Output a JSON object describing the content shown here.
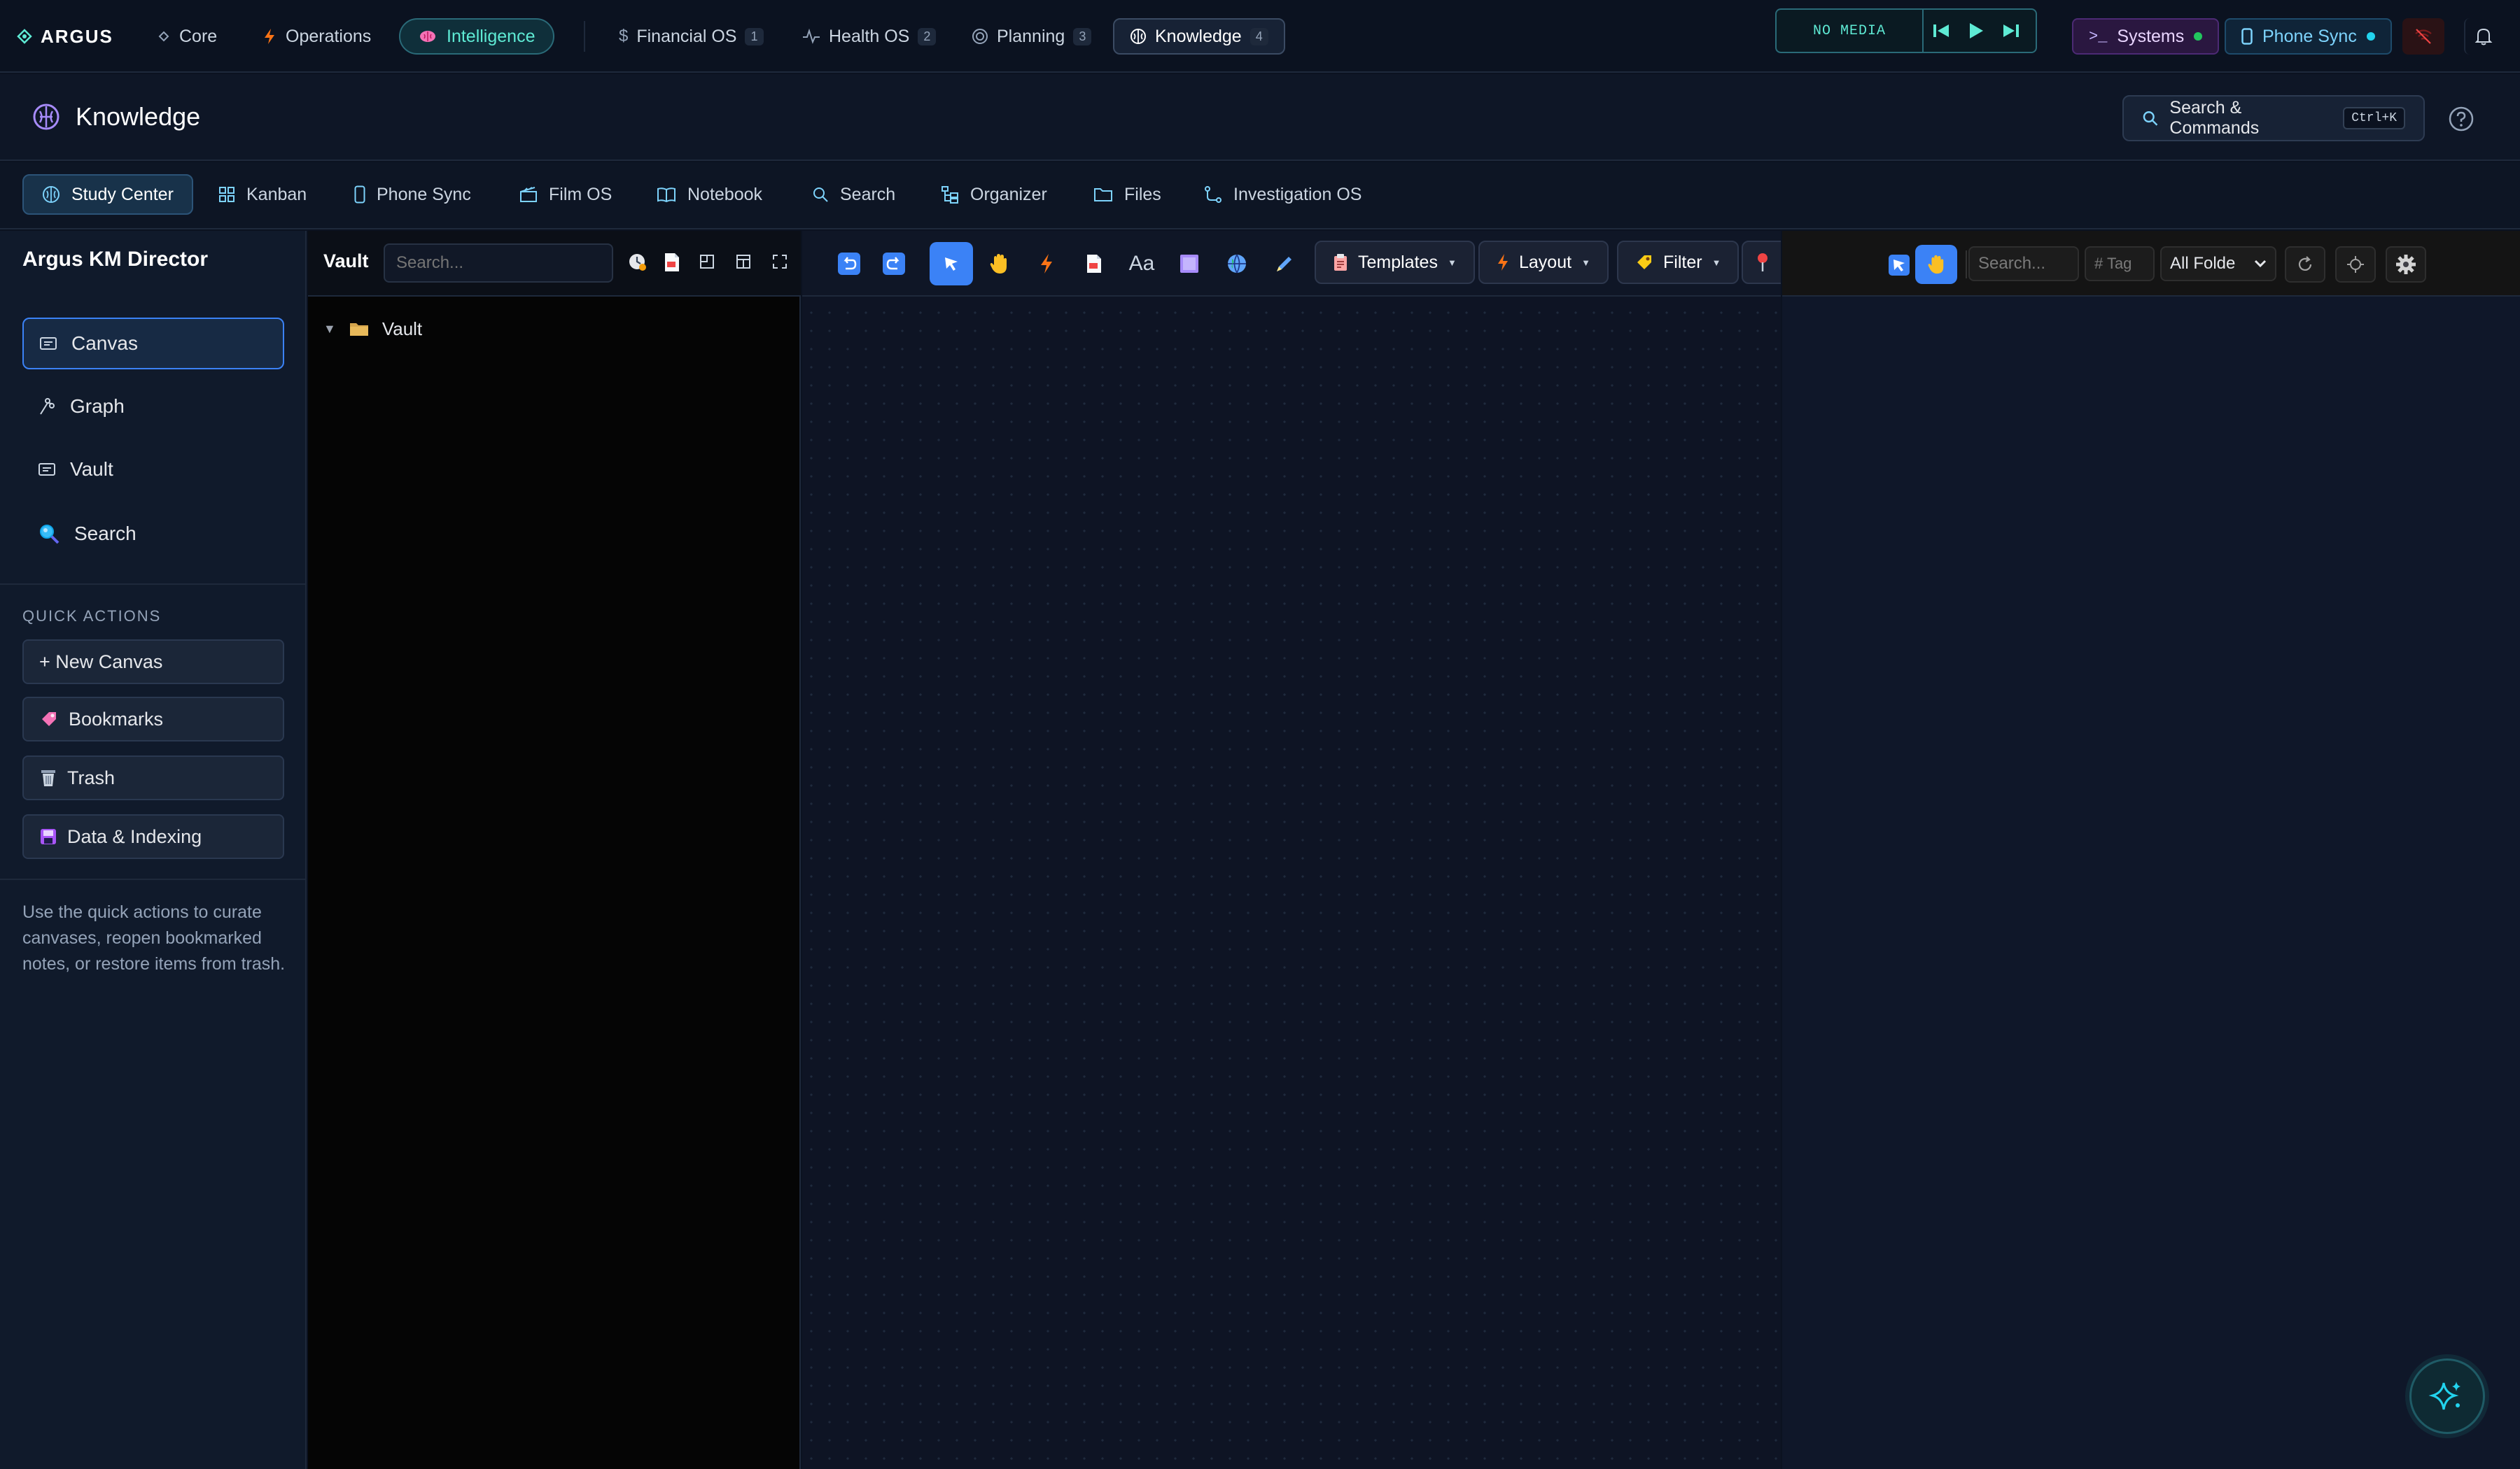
{
  "topbar": {
    "brand": "ARGUS",
    "nav": [
      {
        "label": "Core",
        "icon": "diamond-icon"
      },
      {
        "label": "Operations",
        "icon": "bolt-icon"
      },
      {
        "label": "Intelligence",
        "icon": "brain-icon",
        "active": true
      }
    ],
    "os_nav": [
      {
        "label": "Financial OS",
        "badge": "1",
        "icon": "dollar-icon"
      },
      {
        "label": "Health OS",
        "badge": "2",
        "icon": "pulse-icon"
      },
      {
        "label": "Planning",
        "badge": "3",
        "icon": "target-icon"
      },
      {
        "label": "Knowledge",
        "badge": "4",
        "icon": "brain-icon",
        "active": true
      }
    ],
    "media": {
      "status": "NO MEDIA"
    },
    "systems_label": "Systems",
    "phone_sync_label": "Phone Sync"
  },
  "header": {
    "title": "Knowledge",
    "search_label": "Search & Commands",
    "shortcut": "Ctrl+K"
  },
  "tabs": [
    {
      "label": "Study Center",
      "icon": "brain-icon",
      "active": true
    },
    {
      "label": "Kanban",
      "icon": "grid-icon"
    },
    {
      "label": "Phone Sync",
      "icon": "phone-icon"
    },
    {
      "label": "Film OS",
      "icon": "clapper-icon"
    },
    {
      "label": "Notebook",
      "icon": "book-icon"
    },
    {
      "label": "Search",
      "icon": "search-icon"
    },
    {
      "label": "Organizer",
      "icon": "tree-icon"
    },
    {
      "label": "Files",
      "icon": "folder-icon"
    },
    {
      "label": "Investigation OS",
      "icon": "graph-icon"
    }
  ],
  "sidebar": {
    "title": "Argus KM Director",
    "items": [
      {
        "label": "Canvas",
        "icon": "canvas-icon",
        "active": true
      },
      {
        "label": "Graph",
        "icon": "graph-icon"
      },
      {
        "label": "Vault",
        "icon": "vault-icon"
      },
      {
        "label": "Search",
        "icon": "magnifier-icon"
      }
    ],
    "quick_actions_title": "QUICK ACTIONS",
    "quick_actions": [
      {
        "label": "+ New Canvas",
        "icon": ""
      },
      {
        "label": "Bookmarks",
        "icon": "bookmark-icon"
      },
      {
        "label": "Trash",
        "icon": "trash-icon"
      },
      {
        "label": "Data & Indexing",
        "icon": "disk-icon"
      }
    ],
    "help_text": "Use the quick actions to curate canvases, reopen bookmarked notes, or restore items from trash."
  },
  "vault": {
    "title": "Vault",
    "search_placeholder": "Search...",
    "tree": [
      {
        "label": "Vault",
        "expanded": true
      }
    ]
  },
  "canvas_toolbar": {
    "templates_label": "Templates",
    "layout_label": "Layout",
    "filter_label": "Filter",
    "font_label": "Aa"
  },
  "graph_toolbar": {
    "search_placeholder": "Search...",
    "tag_placeholder": "# Tag",
    "folder_select": "All Folde"
  },
  "colors": {
    "accent_teal": "#5eead4",
    "accent_blue": "#3b82f6",
    "background": "#0b1220",
    "systems_accent": "#a78bfa"
  }
}
